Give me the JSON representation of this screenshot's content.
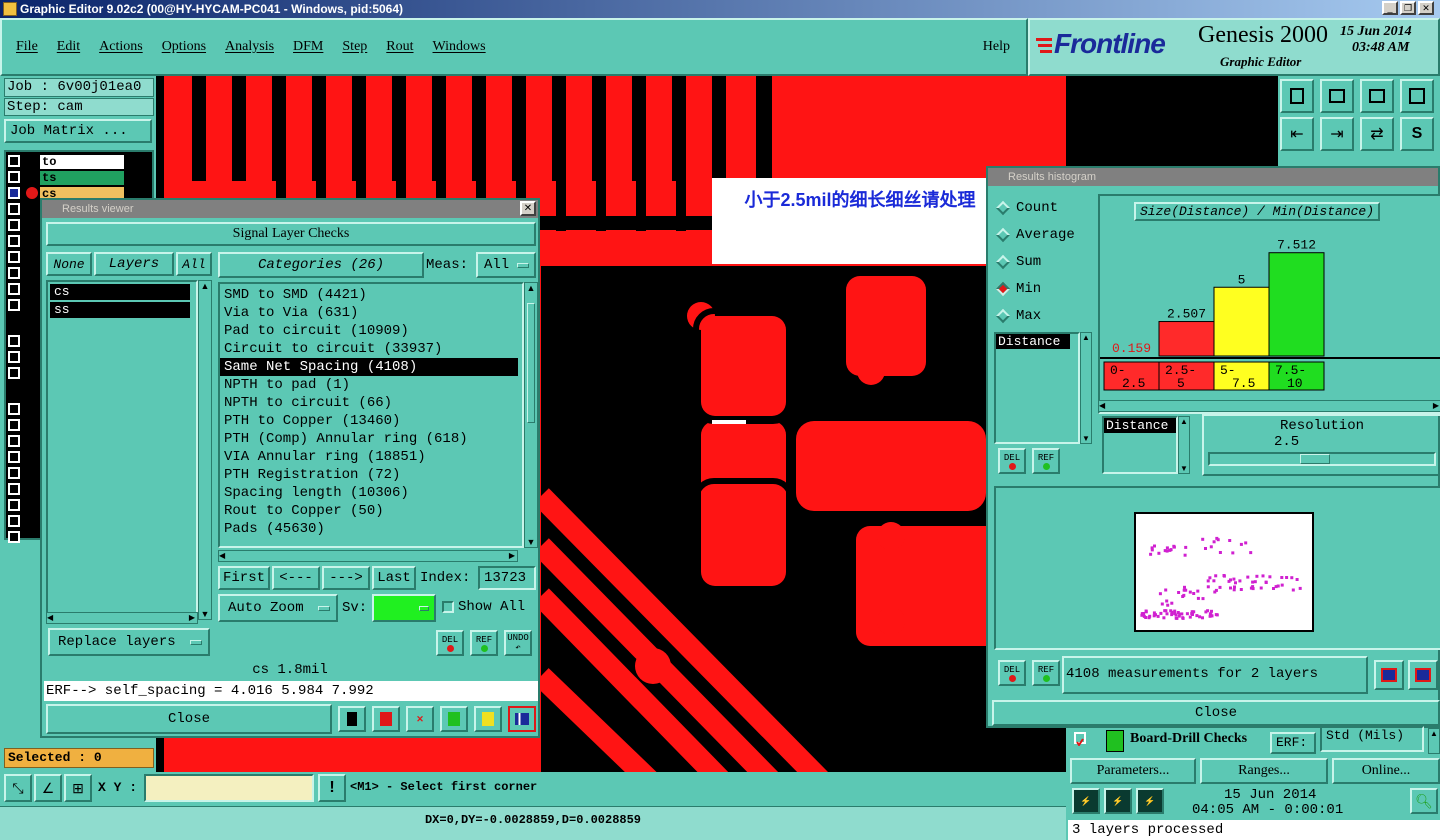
{
  "window": {
    "title": "Graphic Editor 9.02c2 (00@HY-HYCAM-PC041 - Windows, pid:5064)"
  },
  "menu": {
    "items": [
      "File",
      "Edit",
      "Actions",
      "Options",
      "Analysis",
      "DFM",
      "Step",
      "Rout",
      "Windows"
    ],
    "help": "Help"
  },
  "brand": {
    "logo": "Frontline",
    "product": "Genesis 2000",
    "subtitle": "Graphic Editor",
    "date": "15 Jun 2014",
    "time": "03:48 AM"
  },
  "job": {
    "job_label": "Job : 6v00j01ea0",
    "step_label": "Step: cam",
    "matrix_button": "Job Matrix ..."
  },
  "layers_panel": {
    "rows": [
      {
        "name": "to",
        "color": "#ffffff"
      },
      {
        "name": "ts",
        "color": "#20a060"
      },
      {
        "name": "cs",
        "color": "#f0c060"
      }
    ],
    "selected_label": "Selected : 0"
  },
  "annotation": {
    "text": "小于2.5mil的细长细丝请处理"
  },
  "results_viewer": {
    "title": "Results viewer",
    "header": "Signal Layer Checks",
    "none_btn": "None",
    "layers_btn": "Layers",
    "all_btn": "All",
    "categories_btn": "Categories (26)",
    "meas_label": "Meas:",
    "meas_value": "All",
    "layers": [
      "cs",
      "ss"
    ],
    "categories": [
      "SMD to SMD (4421)",
      "Via to Via (631)",
      "Pad to circuit (10909)",
      "Circuit to circuit (33937)",
      "Same Net Spacing (4108)",
      "NPTH to pad (1)",
      "NPTH to circuit (66)",
      "PTH to Copper (13460)",
      "PTH (Comp) Annular ring (618)",
      "VIA Annular ring (18851)",
      "PTH Registration (72)",
      "Spacing length (10306)",
      "Rout to Copper (50)",
      "Pads (45630)"
    ],
    "selected_category_index": 4,
    "nav": {
      "first": "First",
      "prev": "<---",
      "next": "--->",
      "last": "Last",
      "index_label": "Index:",
      "index_value": "13723"
    },
    "auto_zoom": "Auto Zoom",
    "sv_label": "Sv:",
    "show_all": "Show All",
    "replace_layers": "Replace layers",
    "del": "DEL",
    "ref": "REF",
    "undo": "UNDO",
    "layer_info": "cs 1.8mil",
    "erf_line": "ERF--> self_spacing = 4.016 5.984 7.992",
    "close": "Close"
  },
  "histogram": {
    "title": "Results histogram",
    "options": [
      "Count",
      "Average",
      "Sum",
      "Min",
      "Max"
    ],
    "selected_option": "Min",
    "chart_title": "Size(Distance) / Min(Distance)",
    "distance_label": "Distance",
    "distance_label2": "Distance",
    "resolution_label": "Resolution",
    "resolution_value": "2.5",
    "resolution_fraction": 0.4,
    "del": "DEL",
    "ref": "REF",
    "measurements": "4108 measurements for 2 layers",
    "close": "Close"
  },
  "chart_data": {
    "type": "bar",
    "title": "Size(Distance) / Min(Distance)",
    "categories": [
      "0-2.5",
      "2.5-5",
      "5-7.5",
      "7.5-10"
    ],
    "values": [
      0.159,
      2.507,
      5,
      7.512
    ],
    "value_labels": [
      "0.159",
      "2.507",
      "5",
      "7.512"
    ],
    "category_labels": [
      [
        "0-",
        "2.5"
      ],
      [
        "2.5-",
        "5"
      ],
      [
        "5-",
        "7.5"
      ],
      [
        "7.5-",
        "10"
      ]
    ],
    "colors": [
      "#ff2a2a",
      "#ff2a2a",
      "#ffff20",
      "#20dd20"
    ],
    "ylim": [
      0,
      8
    ]
  },
  "drill_panel": {
    "checks_label": "Board-Drill Checks",
    "erf_label": "ERF:",
    "erf_value": "Std (Mils)",
    "parameters": "Parameters...",
    "ranges": "Ranges...",
    "online": "Online...",
    "date": "15 Jun 2014",
    "time": "04:05 AM - 0:00:01",
    "status": "3 layers processed"
  },
  "bottom": {
    "xy_label": "X Y :",
    "hint": "<M1> - Select first corner",
    "readout": "DX=0,DY=-0.0028859,D=0.0028859"
  }
}
